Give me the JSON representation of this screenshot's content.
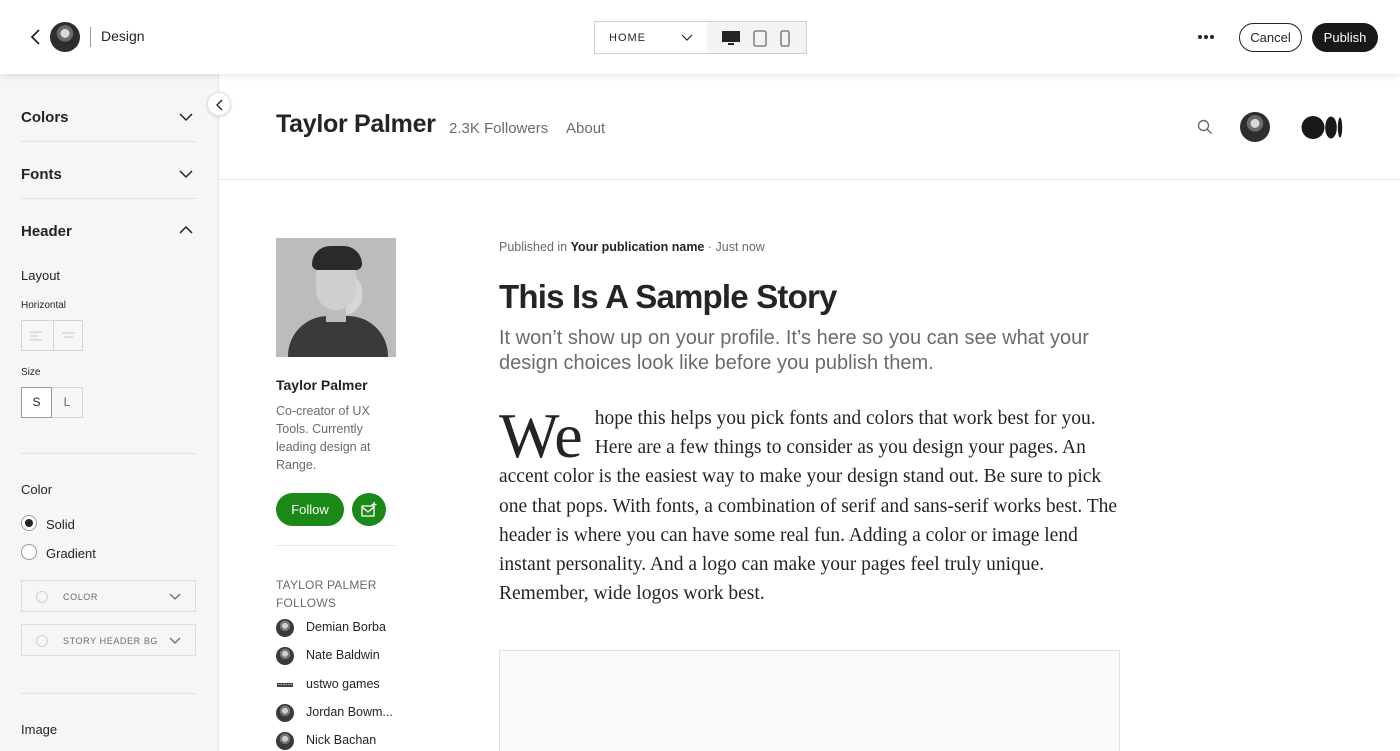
{
  "topbar": {
    "title": "Design",
    "page_select": "HOME",
    "cancel_label": "Cancel",
    "publish_label": "Publish"
  },
  "sidebar": {
    "colors": "Colors",
    "fonts": "Fonts",
    "header": "Header",
    "layout_label": "Layout",
    "horizontal_label": "Horizontal",
    "size_label": "Size",
    "size_s": "S",
    "size_l": "L",
    "color_label": "Color",
    "solid_label": "Solid",
    "gradient_label": "Gradient",
    "color_dropdown": "COLOR",
    "story_header_bg_dropdown": "STORY HEADER BG",
    "image_label": "Image"
  },
  "profile_header": {
    "name": "Taylor Palmer",
    "followers": "2.3K Followers",
    "about": "About"
  },
  "author_card": {
    "name": "Taylor Palmer",
    "bio": "Co-creator of UX Tools. Currently leading design at Range.",
    "follow_label": "Follow",
    "follows_heading": "TAYLOR PALMER FOLLOWS",
    "follows": [
      "Demian Borba",
      "Nate Baldwin",
      "ustwo games",
      "Jordan Bowm...",
      "Nick Bachan"
    ]
  },
  "story": {
    "published_prefix": "Published in ",
    "publication": "Your publication name",
    "published_suffix": " · Just now",
    "title": "This Is A Sample Story",
    "subtitle": "It won’t show up on your profile. It’s here so you can see what your design choices look like before you publish them.",
    "dropcap": "We",
    "body": "hope this helps you pick fonts and colors that work best for you. Here are a few things to consider as you design your pages. An accent color is the easiest way to make your design stand out. Be sure to pick one that pops. With fonts, a combination of serif and sans-serif works best. The header is where you can have some real fun. Adding a color or image lend instant personality. And a logo can make your pages feel truly unique. Remember, wide logos work best."
  },
  "colors": {
    "accent_green": "#1a8917",
    "publish_bg": "#191919",
    "sidebar_bg": "#f6f6f6"
  },
  "icons": [
    "back-arrow-icon",
    "chevron-down-icon",
    "desktop-icon",
    "tablet-icon",
    "mobile-icon",
    "more-icon",
    "search-icon",
    "medium-logo-icon",
    "subscribe-mail-icon",
    "chevron-up-icon",
    "chevron-left-icon"
  ]
}
